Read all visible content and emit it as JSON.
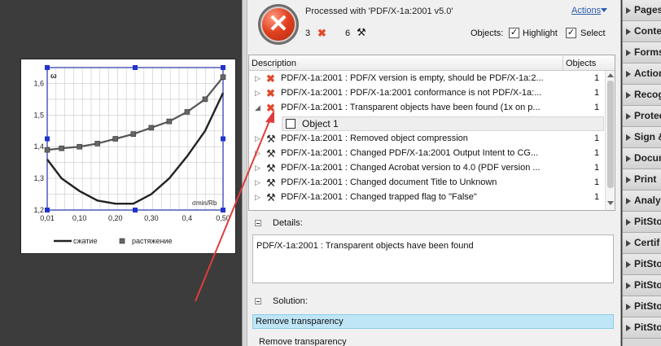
{
  "summary": {
    "processed_with": "Processed with 'PDF/X-1a:2001 v5.0'",
    "actions": "Actions",
    "error_count": "3",
    "fixup_count": "6",
    "objects_label": "Objects:",
    "highlight_label": "Highlight",
    "select_label": "Select",
    "highlight_checked": true,
    "select_checked": true
  },
  "results": {
    "col_description": "Description",
    "col_objects": "Objects",
    "rows": [
      {
        "type": "error",
        "text": "PDF/X-1a:2001 : PDF/X version is empty, should be PDF/X-1a:2...",
        "count": "1"
      },
      {
        "type": "error",
        "text": "PDF/X-1a:2001 : PDF/X-1a:2001 conformance is not PDF/X-1a:...",
        "count": "1"
      },
      {
        "type": "error",
        "text": "PDF/X-1a:2001 : Transparent objects have been found (1x on p...",
        "count": "1"
      },
      {
        "type": "object",
        "text": "Object 1",
        "count": ""
      },
      {
        "type": "fixup",
        "text": "PDF/X-1a:2001 : Removed object compression",
        "count": "1"
      },
      {
        "type": "fixup",
        "text": "PDF/X-1a:2001 : Changed PDF/X-1a:2001 Output Intent to CG...",
        "count": "1"
      },
      {
        "type": "fixup",
        "text": "PDF/X-1a:2001 : Changed Acrobat version to 4.0 (PDF version ...",
        "count": "1"
      },
      {
        "type": "fixup",
        "text": "PDF/X-1a:2001 : Changed document Title to Unknown",
        "count": "1"
      },
      {
        "type": "fixup",
        "text": "PDF/X-1a:2001 : Changed trapped flag to \"False\"",
        "count": "1"
      }
    ]
  },
  "details": {
    "label": "Details:",
    "text": "PDF/X-1a:2001 : Transparent objects have been found"
  },
  "solution": {
    "label": "Solution:",
    "selected": "Remove transparency",
    "item": "Remove transparency"
  },
  "tools": [
    "Pages",
    "Content",
    "Forms",
    "Actions",
    "Recognize",
    "Protection",
    "Sign &",
    "Document",
    "Print",
    "Analyze",
    "PitStop",
    "Certif",
    "PitStop",
    "PitStop",
    "PitStop",
    "PitStop"
  ],
  "figure": {
    "y_axis_label": "ω",
    "x_axis_label": "σmin/Rb",
    "legend_compression": "сжатие",
    "legend_tension": "растяжение"
  },
  "chart_data": {
    "type": "line",
    "x": [
      0.01,
      0.05,
      0.1,
      0.15,
      0.2,
      0.25,
      0.3,
      0.35,
      0.4,
      0.45,
      0.5
    ],
    "x_tick_labels": [
      "0,01",
      "0,10",
      "0,20",
      "0,30",
      "0,4",
      "0,50"
    ],
    "y_tick_labels": [
      "1,2",
      "1,3",
      "1,4",
      "1,5",
      "1,6"
    ],
    "xlim": [
      0.01,
      0.5
    ],
    "ylim": [
      1.2,
      1.65
    ],
    "series": [
      {
        "name": "сжатие",
        "values": [
          1.36,
          1.3,
          1.26,
          1.23,
          1.22,
          1.22,
          1.25,
          1.3,
          1.37,
          1.45,
          1.57
        ]
      },
      {
        "name": "растяжение",
        "values": [
          1.39,
          1.395,
          1.4,
          1.41,
          1.425,
          1.44,
          1.46,
          1.48,
          1.51,
          1.55,
          1.62
        ]
      }
    ],
    "grid": true,
    "legend_position": "bottom"
  },
  "colors": {
    "accent_link": "#2a5db0",
    "error": "#e04a2a",
    "selection": "#bfe6f7",
    "annotation": "#e03c3c"
  }
}
